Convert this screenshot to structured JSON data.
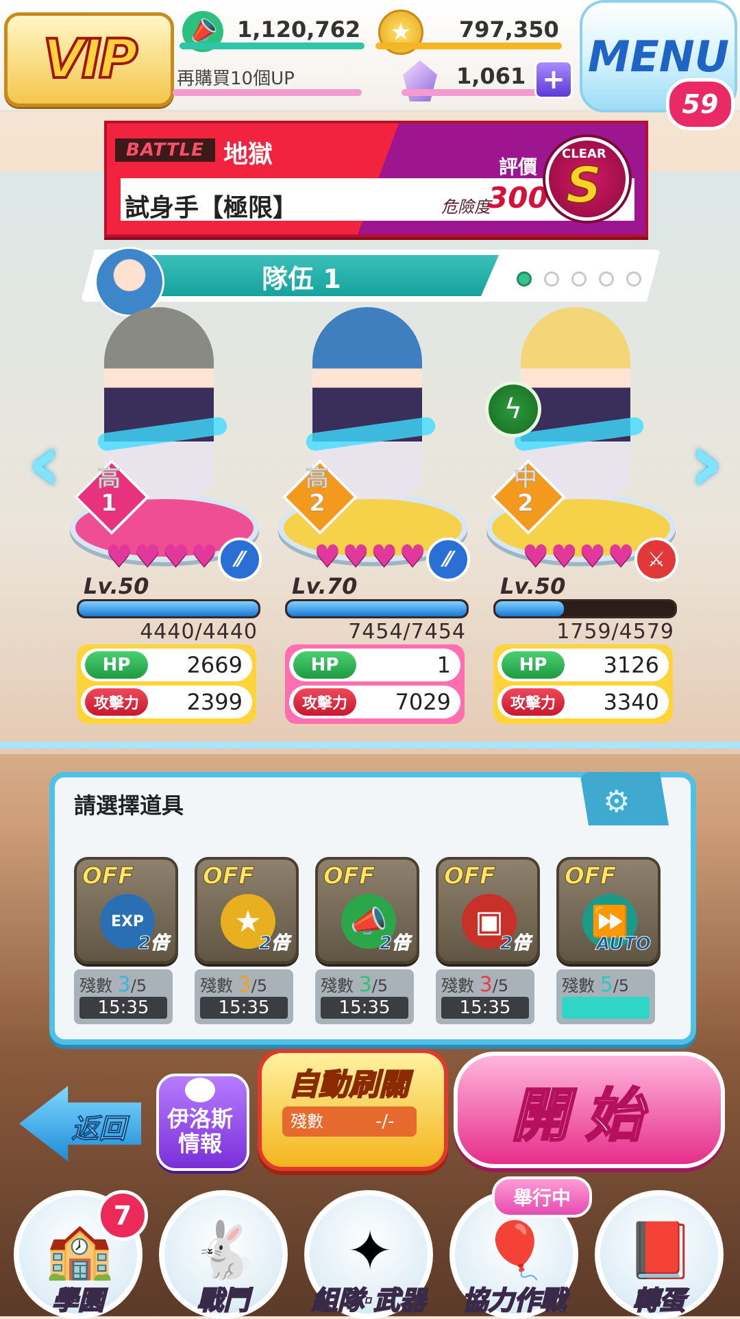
{
  "top_bar": {
    "vip_label": "VIP",
    "cheers": "1,120,762",
    "coins": "797,350",
    "repurchase_text": "再購買10個UP",
    "gems": "1,061",
    "menu_label": "MENU",
    "menu_badge": "59"
  },
  "battle": {
    "tag": "BATTLE",
    "difficulty": "地獄",
    "stage_name": "試身手【極限】",
    "evaluation_label": "評價",
    "danger_label": "危險度",
    "danger_value": "300",
    "clear_label": "CLEAR",
    "rank": "S"
  },
  "team": {
    "name": "隊伍 1",
    "pages": 5,
    "current_page": 1
  },
  "characters": [
    {
      "rank_top": "高",
      "rank_num": "1",
      "rank_color": "#e8327e",
      "pedestal": "#ef4d94",
      "hair": "#8a8a84",
      "hearts": 4,
      "type_icon": "gun",
      "type_color": "#2a6fd6",
      "level": "Lv.50",
      "exp_text": "4440/4440",
      "exp_frac": 1.0,
      "hp_label": "HP",
      "hp": "2669",
      "atk_label": "攻擊力",
      "atk": "2399",
      "box_color": "#ffd43a"
    },
    {
      "rank_top": "高",
      "rank_num": "2",
      "rank_color": "#f39a1e",
      "pedestal": "#f5d24a",
      "hair": "#3f7fc0",
      "hearts": 4,
      "type_icon": "gun",
      "type_color": "#2a6fd6",
      "level": "Lv.70",
      "exp_text": "7454/7454",
      "exp_frac": 1.0,
      "hp_label": "HP",
      "hp": "1",
      "atk_label": "攻擊力",
      "atk": "7029",
      "box_color": "#ff6fb0"
    },
    {
      "rank_top": "中",
      "rank_num": "2",
      "rank_color": "#f39a1e",
      "pedestal": "#f5d24a",
      "hair": "#f3d677",
      "hearts": 4,
      "type_icon": "sword",
      "type_color": "#e2383a",
      "level": "Lv.50",
      "exp_text": "1759/4579",
      "exp_frac": 0.38,
      "hp_label": "HP",
      "hp": "3126",
      "atk_label": "攻擊力",
      "atk": "3340",
      "box_color": "#ffd43a"
    }
  ],
  "items_panel": {
    "title": "請選擇道具",
    "remain_label": "殘數",
    "items": [
      {
        "status": "OFF",
        "icon": "exp-coin-icon",
        "glyph": "EXP",
        "mult": "2倍",
        "count": "3",
        "max": "/5",
        "time": "15:35",
        "count_color": "#3bb3e0",
        "icon_color": "#2a6fb4"
      },
      {
        "status": "OFF",
        "icon": "gold-coin-icon",
        "glyph": "★",
        "mult": "2倍",
        "count": "3",
        "max": "/5",
        "time": "15:35",
        "count_color": "#f0a01e",
        "icon_color": "#e8b020"
      },
      {
        "status": "OFF",
        "icon": "megaphone-icon",
        "glyph": "📣",
        "mult": "2倍",
        "count": "3",
        "max": "/5",
        "time": "15:35",
        "count_color": "#2ec27a",
        "icon_color": "#2ba64a"
      },
      {
        "status": "OFF",
        "icon": "treasure-chest-icon",
        "glyph": "▣",
        "mult": "2倍",
        "count": "3",
        "max": "/5",
        "time": "15:35",
        "count_color": "#e83a4a",
        "icon_color": "#c8302a"
      },
      {
        "status": "OFF",
        "icon": "fast-forward-icon",
        "glyph": "⏩",
        "mult": "AUTO",
        "count": "5",
        "max": "/5",
        "time": "",
        "count_color": "#2fc8c0",
        "icon_color": "#1a9a8a"
      }
    ]
  },
  "buttons": {
    "back": "返回",
    "info": "伊洛斯\n情報",
    "auto_title": "自動刷關",
    "auto_remain_label": "殘數",
    "auto_remain_value": "-/-",
    "start": "開始"
  },
  "nav": {
    "badge": "7",
    "event_tag": "舉行中",
    "items": [
      {
        "label": "學園",
        "icon": "🏫"
      },
      {
        "label": "戰鬥",
        "icon": "🐇"
      },
      {
        "label": "組隊·武器",
        "icon": "✦"
      },
      {
        "label": "協力作戰",
        "icon": "🎈"
      },
      {
        "label": "轉蛋",
        "icon": "📕"
      }
    ]
  }
}
